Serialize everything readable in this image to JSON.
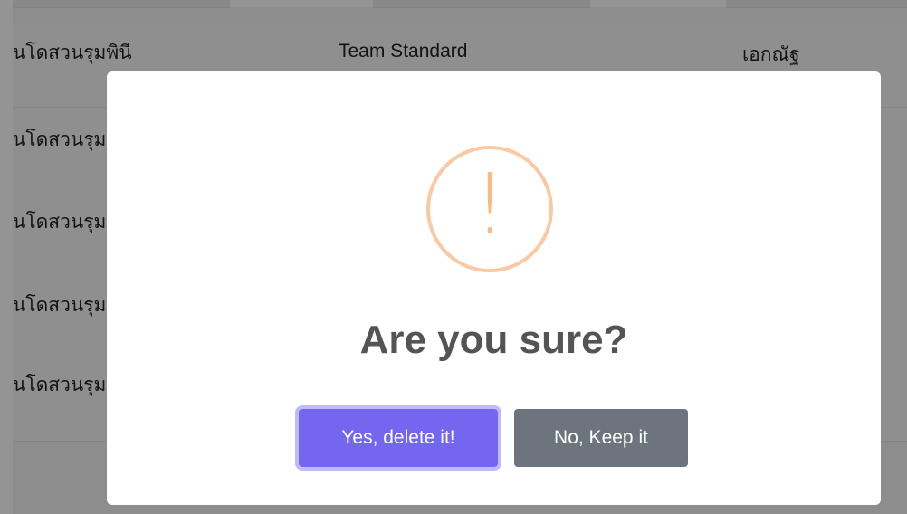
{
  "table": {
    "rows": [
      {
        "col1": "นโดสวนรุมพินี",
        "col2": "Team Standard",
        "col3": "เอกณัฐ"
      },
      {
        "col1": "นโดสวนรุม",
        "col2": "",
        "col3": ""
      },
      {
        "col1": "นโดสวนรุม",
        "col2": "",
        "col3": ""
      },
      {
        "col1": "นโดสวนรุม",
        "col2": "",
        "col3": ""
      },
      {
        "col1": "นโดสวนรุม",
        "col2": "",
        "col3": ""
      }
    ]
  },
  "dialog": {
    "icon": "warning-icon",
    "icon_glyph": "!",
    "title": "Are you sure?",
    "confirm_label": "Yes, delete it!",
    "cancel_label": "No, Keep it"
  },
  "colors": {
    "confirm": "#7367f0",
    "cancel": "#6c757d",
    "warning": "#f8bb86"
  }
}
